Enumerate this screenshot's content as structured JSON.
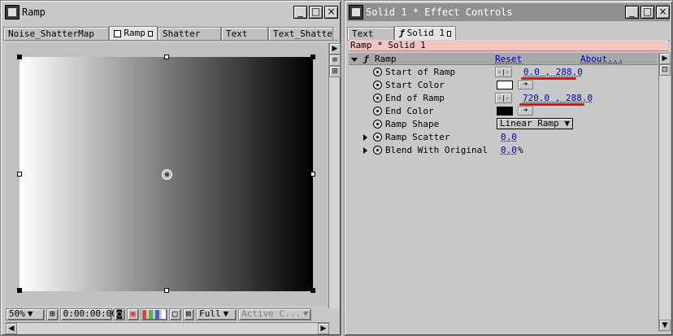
{
  "left_window": {
    "title": "Ramp",
    "tabs": [
      "Noise_ShatterMap",
      "Ramp",
      "Shatter",
      "Text",
      "Text_Shatter"
    ],
    "footer": {
      "zoom": "50%",
      "timecode": "0:00:00:00",
      "resolution": "Full",
      "camera": "Active C..."
    }
  },
  "right_window": {
    "title": "Solid 1 * Effect Controls",
    "tabs": [
      "Text",
      "Solid 1"
    ],
    "layer_label": "Ramp * Solid 1",
    "effect": {
      "name": "Ramp",
      "reset": "Reset",
      "about": "About...",
      "params": {
        "start_of_ramp": {
          "label": "Start of Ramp",
          "value": "0.0 , 288.0"
        },
        "start_color": {
          "label": "Start Color",
          "color": "#ffffff"
        },
        "end_of_ramp": {
          "label": "End of Ramp",
          "value": "720.0 , 288.0"
        },
        "end_color": {
          "label": "End Color",
          "color": "#000000"
        },
        "ramp_shape": {
          "label": "Ramp Shape",
          "value": "Linear Ramp"
        },
        "ramp_scatter": {
          "label": "Ramp Scatter",
          "value": "0.0"
        },
        "blend": {
          "label": "Blend With Original",
          "value": "0.0",
          "unit": "%"
        }
      }
    }
  },
  "colors": {
    "layer_bar": "#f4c4c0",
    "link": "#0000b8",
    "annotation": "#e01010"
  }
}
